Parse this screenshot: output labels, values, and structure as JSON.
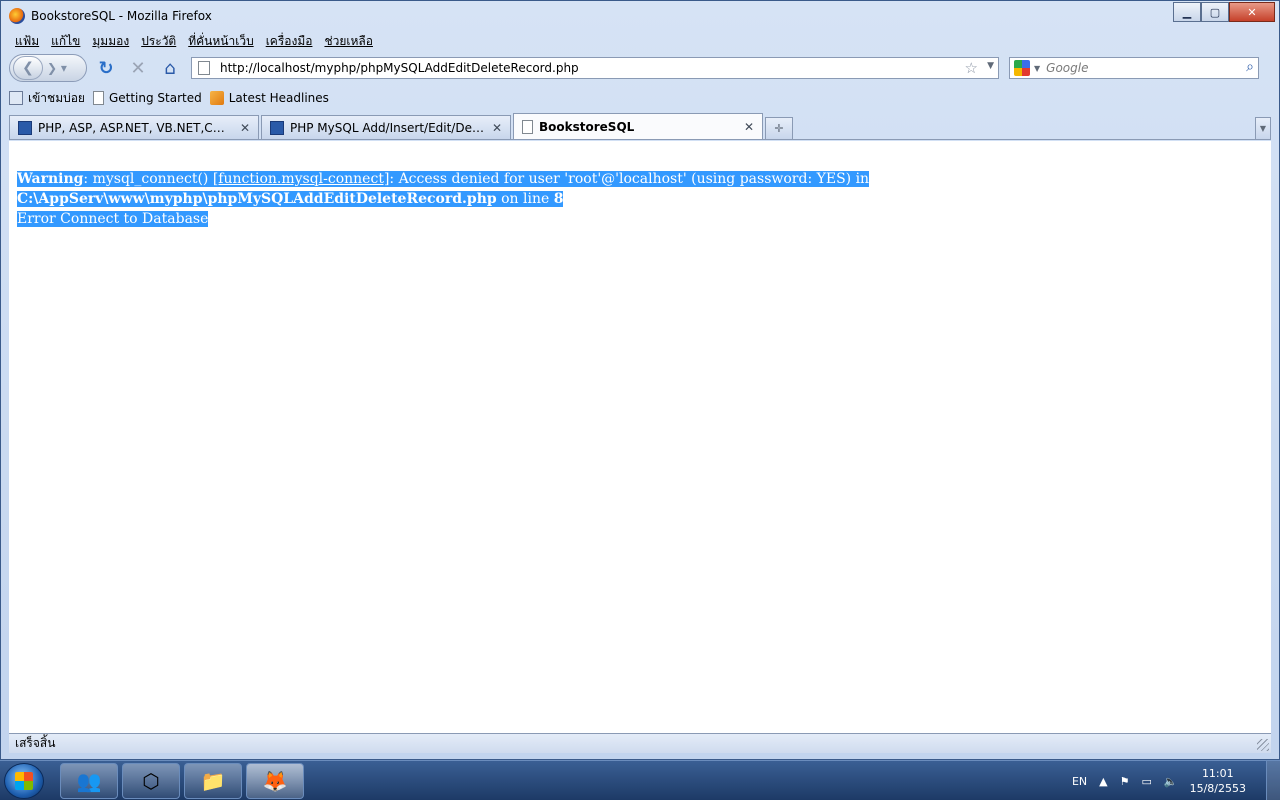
{
  "window": {
    "title": "BookstoreSQL - Mozilla Firefox",
    "minimize": "▁",
    "maximize": "▢",
    "close": "✕"
  },
  "menu": [
    "แฟ้ม",
    "แก้ไข",
    "มุมมอง",
    "ประวัติ",
    "ที่คั่นหน้าเว็บ",
    "เครื่องมือ",
    "ช่วยเหลือ"
  ],
  "navigation": {
    "url": "http://localhost/myphp/phpMySQLAddEditDeleteRecord.php",
    "search_placeholder": "Google"
  },
  "bookmarks": [
    "เข้าชมบ่อย",
    "Getting Started",
    "Latest Headlines"
  ],
  "tabs": [
    {
      "label": "PHP, ASP, ASP.NET, VB.NET,C# Fre...",
      "active": false
    },
    {
      "label": "PHP MySQL Add/Insert/Edit/Delete ...",
      "active": false
    },
    {
      "label": "BookstoreSQL",
      "active": true
    }
  ],
  "page": {
    "warning_label": "Warning",
    "warning_text_1": ": mysql_connect() ",
    "warning_link": "[function.mysql-connect]",
    "warning_text_2": ": Access denied for user 'root'@'localhost' (using password: YES) in ",
    "warning_path": "C:\\AppServ\\www\\myphp\\phpMySQLAddEditDeleteRecord.php",
    "warning_text_3": " on line ",
    "warning_line": "8",
    "error_text": "Error Connect to Database"
  },
  "status": {
    "text": "เสร็จสิ้น"
  },
  "taskbar": {
    "language": "EN",
    "time": "11:01",
    "date": "15/8/2553"
  }
}
